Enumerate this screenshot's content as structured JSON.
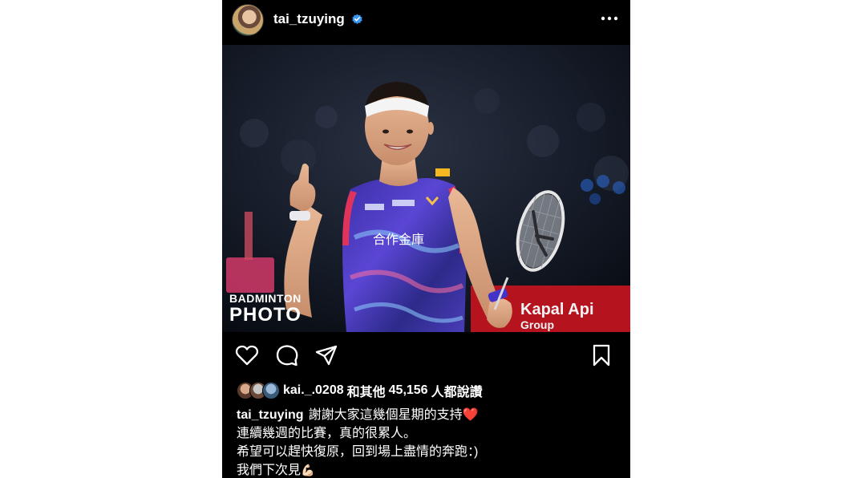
{
  "post": {
    "username": "tai_tzuying",
    "verified": true,
    "more_icon": "more-horizontal-icon",
    "watermark": {
      "line1": "BADMINTON",
      "line2": "PHOTO"
    },
    "jersey_text": "合作金庫",
    "banner_text": "Kapal Api",
    "banner_text2": "Group",
    "actions": {
      "like_icon": "heart-outline-icon",
      "comment_icon": "comment-icon",
      "share_icon": "send-icon",
      "save_icon": "bookmark-icon"
    },
    "likes": {
      "first_liker": "kai._.0208",
      "text": "和其他",
      "count": "45,156",
      "suffix": "人都說讚"
    },
    "caption": {
      "username": "tai_tzuying",
      "line1": "謝謝大家這幾個星期的支持",
      "line1_emoji": "❤️",
      "line2": "連續幾週的比賽，真的很累人。",
      "line3": "希望可以趕快復原，回到場上盡情的奔跑：)",
      "line4": "我們下次見",
      "line4_emoji": "💪🏻"
    },
    "colors": {
      "background": "#000000",
      "verified": "#3897f0",
      "heart": "#e8202f"
    }
  }
}
